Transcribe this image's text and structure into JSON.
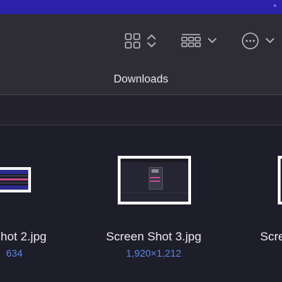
{
  "window": {
    "title": "Downloads"
  },
  "toolbar": {
    "view_icon": "icon-grid-view-icon",
    "view_chevron": "chevron-updown-icon",
    "group_icon": "group-by-icon",
    "group_chevron": "chevron-down-icon",
    "more_icon": "more-ellipsis-icon",
    "more_chevron": "chevron-down-icon"
  },
  "files": [
    {
      "name": "hot 2.jpg",
      "dimensions": "634"
    },
    {
      "name": "Screen Shot 3.jpg",
      "dimensions": "1,920×1,212"
    },
    {
      "name": "Scre",
      "dimensions": ""
    }
  ],
  "colors": {
    "accent_blue": "#5b8ae6",
    "toolbar_bg": "#2e2d34",
    "content_bg": "#1e1d2a",
    "top_strip": "#2b21a8"
  }
}
